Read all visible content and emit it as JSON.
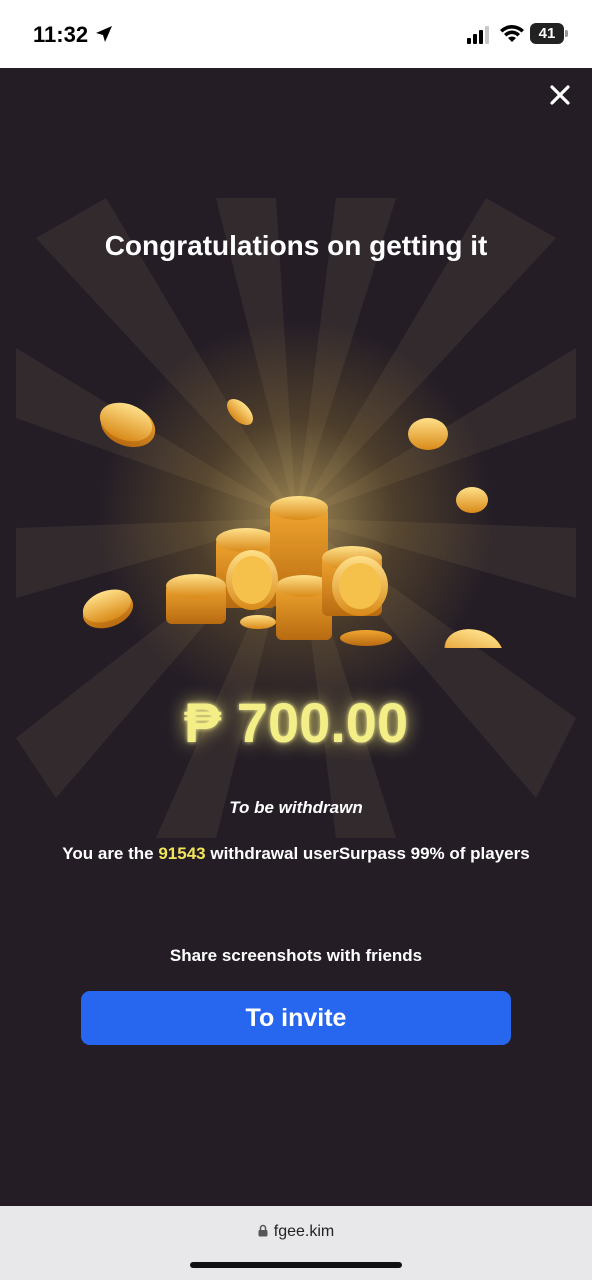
{
  "status_bar": {
    "time": "11:32",
    "battery": "41",
    "icons": [
      "location-arrow-icon",
      "signal-icon",
      "wifi-icon",
      "battery-icon"
    ]
  },
  "modal": {
    "close_icon": "close-icon",
    "title": "Congratulations on getting it",
    "amount": "₱ 700.00",
    "amount_color": "#f4ee86",
    "status": "To be withdrawn",
    "rank_prefix": "You are the ",
    "rank_number": "91543",
    "rank_suffix": " withdrawal userSurpass 99% of players",
    "share_text": "Share screenshots with friends",
    "invite_label": "To invite",
    "invite_color": "#2767ef",
    "background_color": "#241d26"
  },
  "browser": {
    "url": "fgee.kim",
    "lock_icon": "lock-icon"
  }
}
